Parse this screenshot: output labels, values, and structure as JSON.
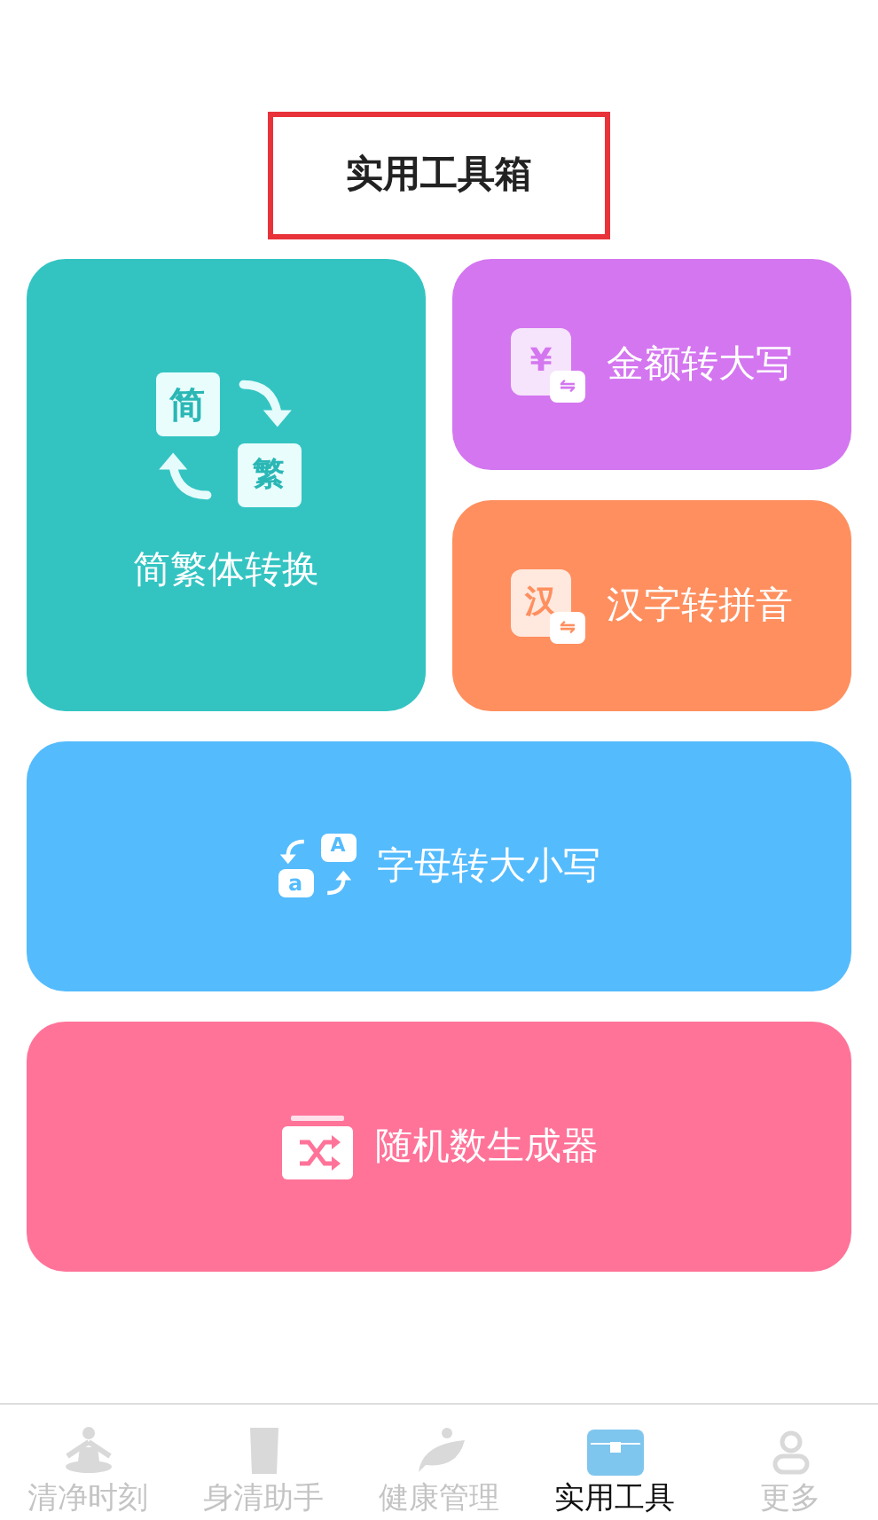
{
  "title": "实用工具箱",
  "tools": [
    {
      "kind": "simplified-traditional",
      "label": "简繁体转换",
      "glyphs": [
        "简",
        "繁"
      ],
      "color": "#33c4c2"
    },
    {
      "kind": "amount",
      "label": "金额转大写",
      "glyphs": [
        "¥",
        "⇋"
      ],
      "color": "#d476f0"
    },
    {
      "kind": "pinyin",
      "label": "汉字转拼音",
      "glyphs": [
        "汉",
        "⇋"
      ],
      "color": "#ff8f5f"
    },
    {
      "kind": "letter-case",
      "label": "字母转大小写",
      "glyphs": [
        "A",
        "a"
      ],
      "color": "#54bbfd"
    },
    {
      "kind": "random",
      "label": "随机数生成器",
      "color": "#ff7399"
    }
  ],
  "tabs": [
    {
      "kind": "meditation",
      "label": "清净时刻",
      "selected": false
    },
    {
      "kind": "cup",
      "label": "身清助手",
      "selected": false
    },
    {
      "kind": "leaf",
      "label": "健康管理",
      "selected": false
    },
    {
      "kind": "chest",
      "label": "实用工具",
      "selected": true
    },
    {
      "kind": "person",
      "label": "更多",
      "selected": false
    }
  ]
}
